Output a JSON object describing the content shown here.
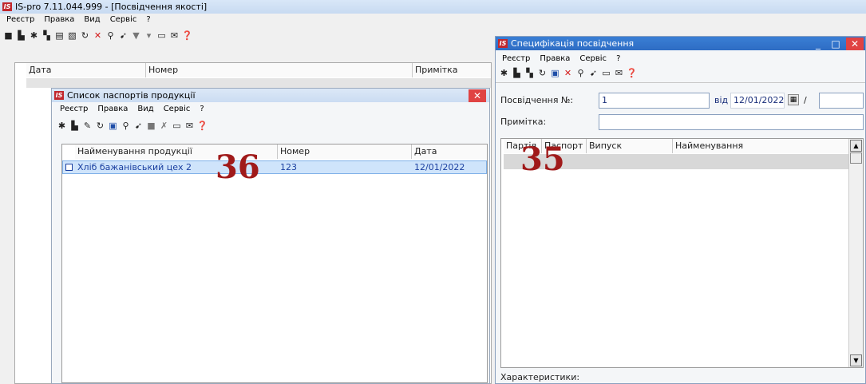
{
  "app": {
    "title": "IS-pro 7.11.044.999 - [Посвідчення якості]",
    "menu": [
      "Реєстр",
      "Правка",
      "Вид",
      "Сервіс",
      "?"
    ]
  },
  "main_grid": {
    "columns": [
      "Дата",
      "Номер",
      "Примітка"
    ]
  },
  "passports_window": {
    "title": "Список паспортів продукції",
    "menu": [
      "Реєстр",
      "Правка",
      "Вид",
      "Сервіс",
      "?"
    ],
    "columns": [
      "Найменування продукції",
      "Номер",
      "Дата"
    ],
    "rows": [
      {
        "name": "Хліб бажанівський цех 2",
        "number": "123",
        "date": "12/01/2022"
      }
    ],
    "callout": "36"
  },
  "spec_window": {
    "title": "Специфікація посвідчення",
    "menu": [
      "Реєстр",
      "Правка",
      "Сервіс",
      "?"
    ],
    "cert_label": "Посвідчення №:",
    "cert_value": "1",
    "from_label": "від",
    "from_date": "12/01/2022",
    "slash": "/",
    "note_label": "Примітка:",
    "note_value": "",
    "columns": [
      "Партія",
      "Паспорт",
      "Випуск",
      "Найменування"
    ],
    "footer_label": "Характеристики:",
    "callout": "35"
  },
  "colors": {
    "accent": "#2e6cc3",
    "close_red": "#e04343",
    "selection": "#cfe4fb"
  }
}
